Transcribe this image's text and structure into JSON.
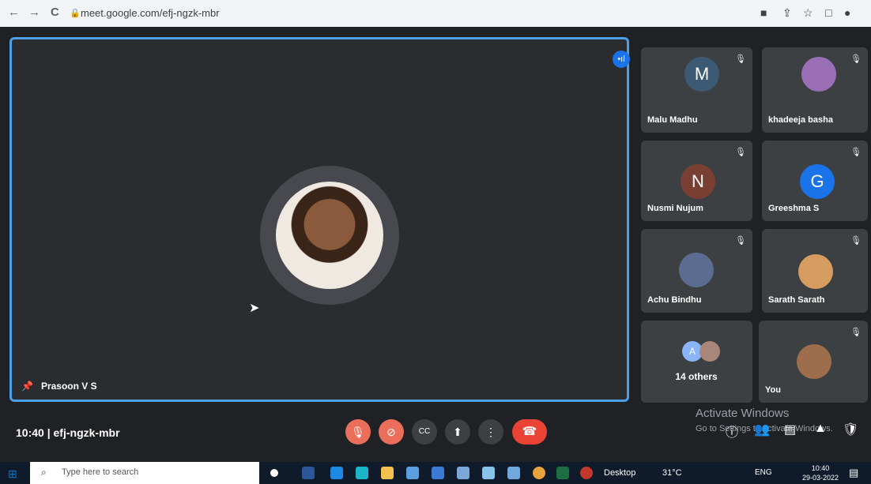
{
  "browser": {
    "back": "←",
    "forward": "→",
    "reload": "C",
    "lock": "🔒",
    "url": "meet.google.com/efj-ngzk-mbr",
    "extensions": [
      "■",
      "⇪",
      "☆",
      "□",
      "●"
    ]
  },
  "main": {
    "speaker_name": "Prasoon V S",
    "speaking_indicator": "•ıl"
  },
  "participants": [
    {
      "name": "Malu Madhu",
      "initial": "M",
      "color": "#3c5a73",
      "mute": "🎙"
    },
    {
      "name": "khadeeja basha",
      "initial": "",
      "color": "#9b6fb5",
      "mute": "🎙"
    },
    {
      "name": "Nusmi Nujum",
      "initial": "N",
      "color": "#7a3f33",
      "mute": "🎙"
    },
    {
      "name": "Greeshma S",
      "initial": "G",
      "color": "#1a73e8",
      "mute": "🎙"
    },
    {
      "name": "Achu Bindhu",
      "initial": "",
      "color": "#5b6c90",
      "mute": "🎙"
    },
    {
      "name": "Sarath Sarath",
      "initial": "",
      "color": "#d59d5f",
      "mute": "🎙"
    },
    {
      "name": "14 others",
      "initial": "A",
      "color": "#8ab4f8",
      "mute": ""
    },
    {
      "name": "You",
      "initial": "",
      "color": "#9e6d4c",
      "mute": "🎙"
    }
  ],
  "bottom": {
    "time": "10:40",
    "separator": "|",
    "meeting_code": "efj-ngzk-mbr",
    "controls": {
      "mic": "🎙",
      "cam": "⊘",
      "cc": "CC",
      "present": "⬆",
      "more": "⋮",
      "end": "☎"
    },
    "right": {
      "info": "ⓘ",
      "people": "👥",
      "chat": "▤",
      "activities": "▲",
      "lock": "🛡"
    },
    "watermark_title": "Activate Windows",
    "watermark_text": "Go to Settings to activate Windows."
  },
  "taskbar": {
    "search_placeholder": "Type here to search",
    "desktop": "Desktop",
    "weather": "31°C",
    "lang": "ENG",
    "clock_time": "10:40",
    "clock_date": "29-03-2022"
  }
}
